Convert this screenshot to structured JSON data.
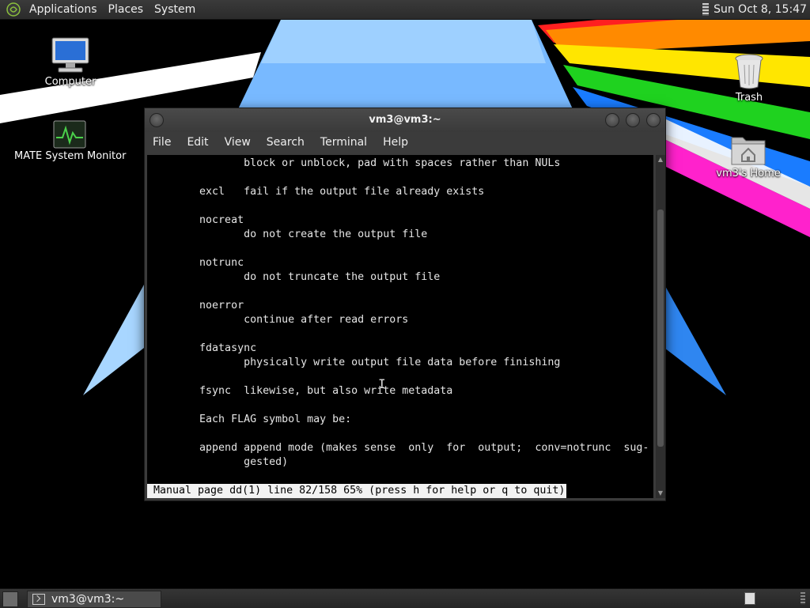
{
  "top_panel": {
    "menus": [
      "Applications",
      "Places",
      "System"
    ],
    "clock": "Sun Oct  8, 15:47"
  },
  "desktop": {
    "icons": [
      {
        "label": "Computer",
        "icon": "computer-icon"
      },
      {
        "label": "MATE System Monitor",
        "icon": "system-monitor-icon"
      },
      {
        "label": "Trash",
        "icon": "trash-icon"
      },
      {
        "label": "vm3's Home",
        "icon": "home-folder-icon"
      }
    ]
  },
  "terminal": {
    "title": "vm3@vm3:~",
    "menu": [
      "File",
      "Edit",
      "View",
      "Search",
      "Terminal",
      "Help"
    ],
    "lines": [
      "              block or unblock, pad with spaces rather than NULs",
      "",
      "       excl   fail if the output file already exists",
      "",
      "       nocreat",
      "              do not create the output file",
      "",
      "       notrunc",
      "              do not truncate the output file",
      "",
      "       noerror",
      "              continue after read errors",
      "",
      "       fdatasync",
      "              physically write output file data before finishing",
      "",
      "       fsync  likewise, but also write metadata",
      "",
      "       Each FLAG symbol may be:",
      "",
      "       append append mode (makes sense  only  for  output;  conv=notrunc  sug-",
      "              gested)"
    ],
    "status_line": "Manual page dd(1) line 82/158 65% (press h for help or q to quit)",
    "scroll_position": 0.52
  },
  "bottom_panel": {
    "task_label": "vm3@vm3:~"
  },
  "colors": {
    "panel": "#2b2b2b",
    "terminal_bg": "#000000",
    "terminal_fg": "#e6e6e6",
    "status_bg": "#f2f2f2"
  }
}
